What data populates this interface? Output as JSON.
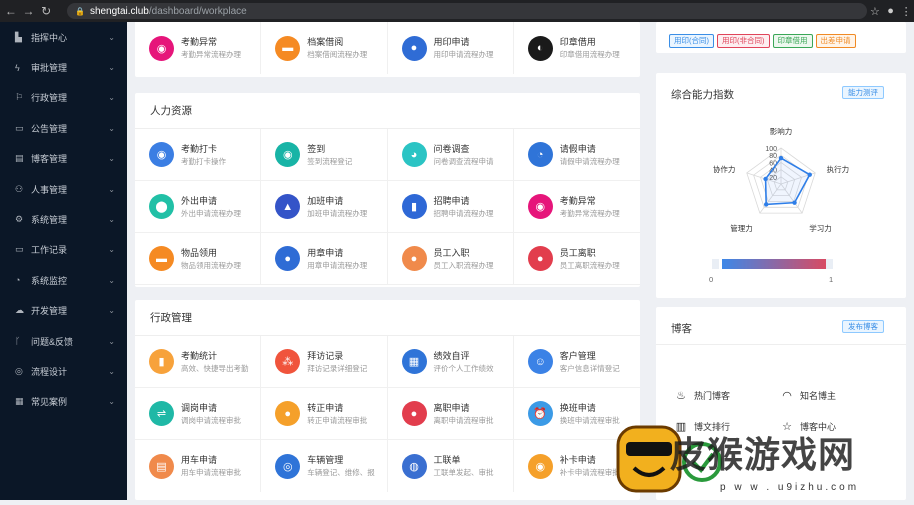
{
  "browser": {
    "back": "←",
    "forward": "→",
    "reload": "↻",
    "lock": "🔒",
    "host": "shengtai.club",
    "path": "/dashboard/workplace",
    "star": "☆",
    "profile": "●",
    "menu": "⋮"
  },
  "sidebar": [
    {
      "label": "指挥中心",
      "icon": "dashboard-icon",
      "glyph": "▙"
    },
    {
      "label": "审批管理",
      "icon": "approval-icon",
      "glyph": "ϟ"
    },
    {
      "label": "行政管理",
      "icon": "admin-icon",
      "glyph": "⚐"
    },
    {
      "label": "公告管理",
      "icon": "announcement-icon",
      "glyph": "▭"
    },
    {
      "label": "博客管理",
      "icon": "blog-icon",
      "glyph": "▤"
    },
    {
      "label": "人事管理",
      "icon": "hr-icon",
      "glyph": "⚇"
    },
    {
      "label": "系统管理",
      "icon": "settings-icon",
      "glyph": "⚙"
    },
    {
      "label": "工作记录",
      "icon": "worklog-icon",
      "glyph": "▭"
    },
    {
      "label": "系统监控",
      "icon": "monitor-icon",
      "glyph": "◔"
    },
    {
      "label": "开发管理",
      "icon": "dev-icon",
      "glyph": "☁"
    },
    {
      "label": "问题&反馈",
      "icon": "feedback-icon",
      "glyph": "ᚴ"
    },
    {
      "label": "流程设计",
      "icon": "workflow-icon",
      "glyph": "◎"
    },
    {
      "label": "常见案例",
      "icon": "cases-icon",
      "glyph": "▦"
    }
  ],
  "top_card": {
    "items": [
      {
        "title": "考勤异常",
        "sub": "考勤异常流程办理",
        "icon": "attendance-exception-icon",
        "color": "#e6157a",
        "glyph": "◉"
      },
      {
        "title": "档案借阅",
        "sub": "档案借阅流程办理",
        "icon": "archive-borrow-icon",
        "color": "#f58a23",
        "glyph": "▬"
      },
      {
        "title": "用印申请",
        "sub": "用印申请流程办理",
        "icon": "seal-apply-icon",
        "color": "#2f6cd5",
        "glyph": "●"
      },
      {
        "title": "印章借用",
        "sub": "印章借用流程办理",
        "icon": "seal-borrow-icon",
        "color": "#1a1a1a",
        "glyph": "◐"
      }
    ]
  },
  "hr_card": {
    "title": "人力资源",
    "items": [
      {
        "title": "考勤打卡",
        "sub": "考勤打卡操作",
        "icon": "clock-in-icon",
        "color": "#3b7ee3",
        "glyph": "◉"
      },
      {
        "title": "签到",
        "sub": "签到流程登记",
        "icon": "sign-in-icon",
        "color": "#18b4a6",
        "glyph": "◉"
      },
      {
        "title": "问卷调查",
        "sub": "问卷调查流程申请",
        "icon": "survey-icon",
        "color": "#2bc4c4",
        "glyph": "◕"
      },
      {
        "title": "请假申请",
        "sub": "请假申请流程办理",
        "icon": "leave-icon",
        "color": "#2f74d8",
        "glyph": "◔"
      },
      {
        "title": "外出申请",
        "sub": "外出申请流程办理",
        "icon": "outing-icon",
        "color": "#21c0a6",
        "glyph": "⬤"
      },
      {
        "title": "加班申请",
        "sub": "加班申请流程办理",
        "icon": "overtime-icon",
        "color": "#3454c8",
        "glyph": "▲"
      },
      {
        "title": "招聘申请",
        "sub": "招聘申请流程办理",
        "icon": "recruit-icon",
        "color": "#2e68d6",
        "glyph": "▮"
      },
      {
        "title": "考勤异常",
        "sub": "考勤异常流程办理",
        "icon": "attendance-exception-icon",
        "color": "#e6157a",
        "glyph": "◉"
      },
      {
        "title": "物品领用",
        "sub": "物品领用流程办理",
        "icon": "goods-icon",
        "color": "#f58a23",
        "glyph": "▬"
      },
      {
        "title": "用章申请",
        "sub": "用章申请流程办理",
        "icon": "stamp-icon",
        "color": "#2f6cd5",
        "glyph": "●"
      },
      {
        "title": "员工入职",
        "sub": "员工入职流程办理",
        "icon": "onboard-icon",
        "color": "#f08a4b",
        "glyph": "●"
      },
      {
        "title": "员工离职",
        "sub": "员工离职流程办理",
        "icon": "resign-icon",
        "color": "#e23d4d",
        "glyph": "●"
      }
    ]
  },
  "admin_card": {
    "title": "行政管理",
    "items": [
      {
        "title": "考勤统计",
        "sub": "高效、快捷导出考勤",
        "icon": "stats-icon",
        "color": "#f7a23b",
        "glyph": "▮"
      },
      {
        "title": "拜访记录",
        "sub": "拜访记录详细登记",
        "icon": "visit-icon",
        "color": "#f0543c",
        "glyph": "⁂"
      },
      {
        "title": "绩效自评",
        "sub": "评价个人工作绩效",
        "icon": "performance-icon",
        "color": "#2f74d8",
        "glyph": "▦"
      },
      {
        "title": "客户管理",
        "sub": "客户信息详情登记",
        "icon": "customer-icon",
        "color": "#3b82e6",
        "glyph": "☺"
      },
      {
        "title": "调岗申请",
        "sub": "调岗申请流程审批",
        "icon": "transfer-icon",
        "color": "#1fb8a6",
        "glyph": "⇌"
      },
      {
        "title": "转正申请",
        "sub": "转正申请流程审批",
        "icon": "regular-icon",
        "color": "#f5a02a",
        "glyph": "●"
      },
      {
        "title": "离职申请",
        "sub": "离职申请流程审批",
        "icon": "leave-job-icon",
        "color": "#e23d4d",
        "glyph": "●"
      },
      {
        "title": "换班申请",
        "sub": "换班申请流程审批",
        "icon": "shift-icon",
        "color": "#3b9ae6",
        "glyph": "⏰"
      },
      {
        "title": "用车申请",
        "sub": "用车申请流程审批",
        "icon": "car-icon",
        "color": "#f08a4b",
        "glyph": "▤"
      },
      {
        "title": "车辆管理",
        "sub": "车辆登记、维修、报",
        "icon": "vehicle-icon",
        "color": "#2f74d8",
        "glyph": "◎"
      },
      {
        "title": "工联单",
        "sub": "工联单发起、审批",
        "icon": "workorder-icon",
        "color": "#3a6fd1",
        "glyph": "◍"
      },
      {
        "title": "补卡申请",
        "sub": "补卡申请流程审批",
        "icon": "reissue-card-icon",
        "color": "#f5a02a",
        "glyph": "◉"
      }
    ]
  },
  "seal_tags": [
    {
      "label": "用印(合同)",
      "color": "#3a8ee6",
      "bg": "#eaf5ff"
    },
    {
      "label": "用印(非合同)",
      "color": "#e0445a",
      "bg": "#fdeef0"
    },
    {
      "label": "印章借用",
      "color": "#3aa757",
      "bg": "#edf8ef"
    },
    {
      "label": "出差申请",
      "color": "#f08a24",
      "bg": "#fff4e8"
    }
  ],
  "ability": {
    "title": "综合能力指数",
    "button": "能力测评",
    "axes": [
      "影响力",
      "执行力",
      "学习力",
      "管理力",
      "协作力"
    ],
    "values": [
      72,
      84,
      64,
      70,
      45
    ],
    "ticks": [
      "100",
      "80",
      "60",
      "40",
      "20"
    ],
    "scale_min": "0",
    "scale_max": "1"
  },
  "blog": {
    "title": "博客",
    "button": "发布博客",
    "links": [
      {
        "label": "热门博客",
        "icon": "fire-icon",
        "glyph": "♨"
      },
      {
        "label": "知名博主",
        "icon": "rss-icon",
        "glyph": "◠"
      },
      {
        "label": "博文排行",
        "icon": "bar-chart-icon",
        "glyph": "▥"
      },
      {
        "label": "博客中心",
        "icon": "star-icon",
        "glyph": "☆"
      }
    ]
  },
  "watermark": {
    "text": "皮猴游戏网",
    "url": "p w w .  u9izhu.com"
  }
}
